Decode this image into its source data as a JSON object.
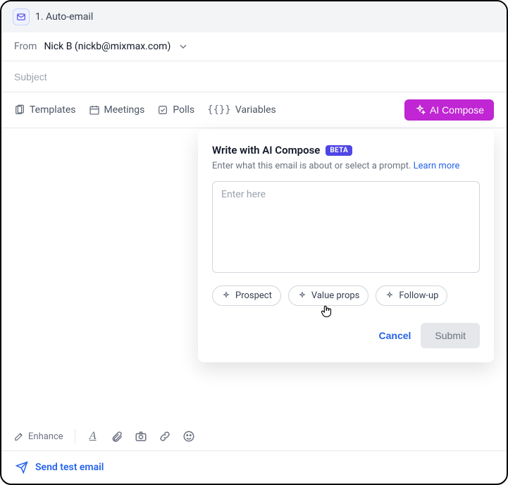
{
  "header": {
    "stage_title": "1. Auto-email"
  },
  "from": {
    "label": "From",
    "value": "Nick B (nickb@mixmax.com)"
  },
  "subject": {
    "placeholder": "Subject"
  },
  "toolbar": {
    "templates": "Templates",
    "meetings": "Meetings",
    "polls": "Polls",
    "variables": "Variables",
    "ai_compose": "AI Compose"
  },
  "popover": {
    "title": "Write with AI Compose",
    "beta": "BETA",
    "subtitle_pre": "Enter what this email is about or select a prompt. ",
    "learn_more": "Learn more",
    "placeholder": "Enter here",
    "chips": {
      "prospect": "Prospect",
      "value_props": "Value props",
      "follow_up": "Follow-up"
    },
    "cancel": "Cancel",
    "submit": "Submit"
  },
  "lower": {
    "enhance": "Enhance"
  },
  "footer": {
    "send_test": "Send test email"
  }
}
